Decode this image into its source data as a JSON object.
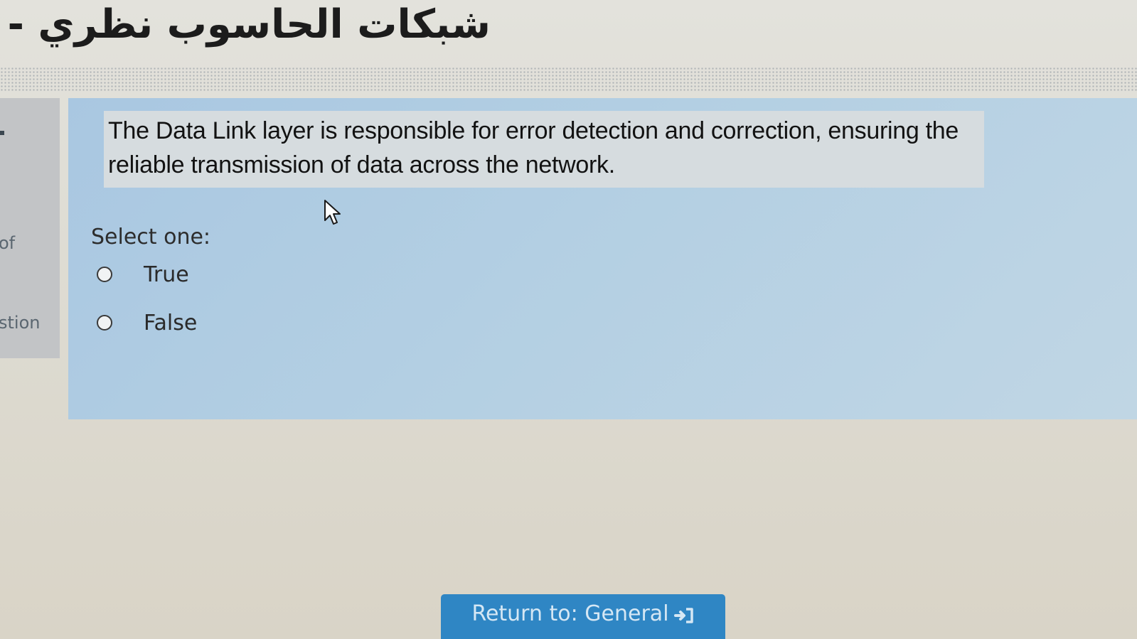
{
  "header": {
    "course_title": "شبكات الحاسوب نظري - "
  },
  "left_nav": {
    "item_of": "of",
    "item_question": "stion"
  },
  "question": {
    "text": "The Data Link layer is responsible for error detection and correction, ensuring the reliable transmission of data across the network.",
    "select_label": "Select one:",
    "options": [
      {
        "label": "True",
        "selected": false
      },
      {
        "label": "False",
        "selected": false
      }
    ]
  },
  "footer": {
    "return_label": "Return to: General",
    "return_icon": "sign-in-arrow-icon"
  },
  "colors": {
    "card": "#b3cfe3",
    "button": "#2f86c4",
    "question_box": "#d6dcdf"
  }
}
